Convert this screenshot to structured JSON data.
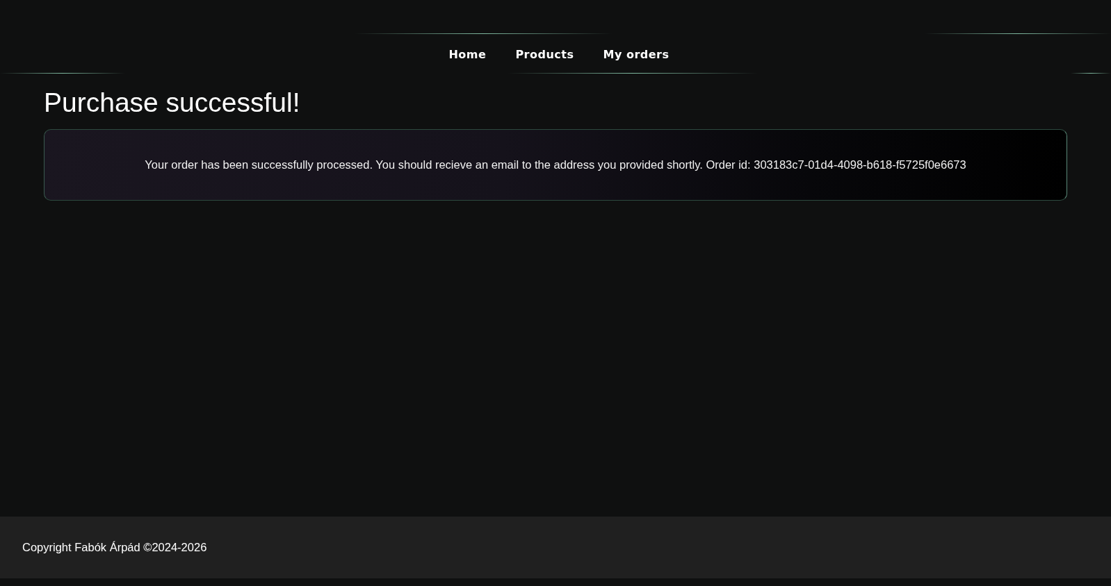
{
  "nav": {
    "links": [
      {
        "label": "Home"
      },
      {
        "label": "Products"
      },
      {
        "label": "My orders"
      }
    ]
  },
  "heading": "Purchase successful!",
  "message": "Your order has been successfully processed. You should recieve an email to the address you provided shortly. Order id: 303183c7-01d4-4098-b618-f5725f0e6673",
  "footer": {
    "copyright": "Copyright Fabók Árpád ©2024-2026"
  }
}
